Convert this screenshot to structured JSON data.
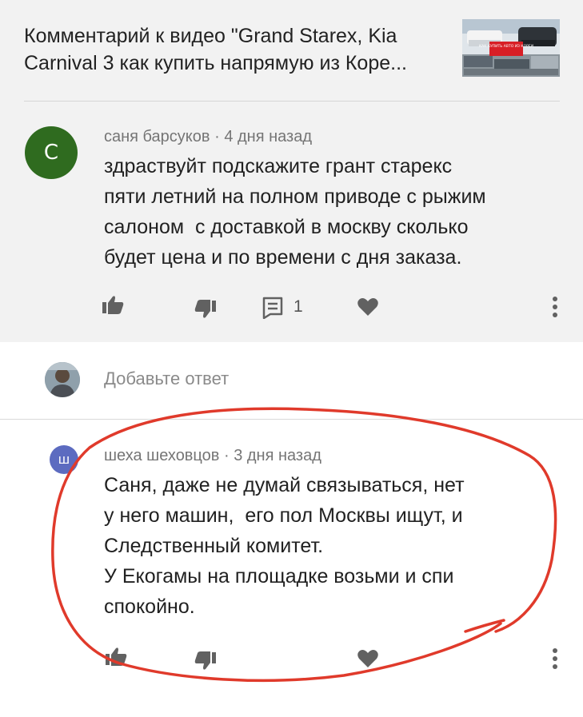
{
  "header": {
    "title": "Комментарий к видео \"Grand Starex, Kia Carnival 3 как купить напрямую из Коре...",
    "thumbnail_caption": "КАК КУПИТЬ АВТО ИЗ КОРЕИ"
  },
  "comment": {
    "avatar_letter": "С",
    "author": "саня барсуков",
    "time": "4 дня назад",
    "text_lines": [
      "здраствуйт подскажите грант старекс",
      "пяти летний на полном приводе с рыжим",
      "салоном  с доставкой в москву сколько",
      "будет цена и по времени с дня заказа."
    ],
    "reply_count": "1",
    "actions": {
      "like_icon": "thumb-up-icon",
      "dislike_icon": "thumb-down-icon",
      "reply_icon": "comment-icon",
      "heart_icon": "heart-icon",
      "more_icon": "more-vert-icon"
    }
  },
  "reply_box": {
    "placeholder": "Добавьте ответ"
  },
  "reply": {
    "avatar_letter": "ш",
    "author": "шеха шеховцов",
    "time": "3 дня назад",
    "text_lines": [
      "Саня, даже не думай связываться, нет",
      "у него машин,  его пол Москвы ищут, и",
      "Следственный комитет.",
      "У Екогамы на площадке возьми и спи",
      "спокойно."
    ]
  },
  "colors": {
    "top_background": "#f2f2f2",
    "avatar_c": "#2f6b1f",
    "avatar_sh": "#5c6bc0",
    "highlight_ring": "#e03a2b",
    "thumbnail_banner": "#d81f26"
  }
}
